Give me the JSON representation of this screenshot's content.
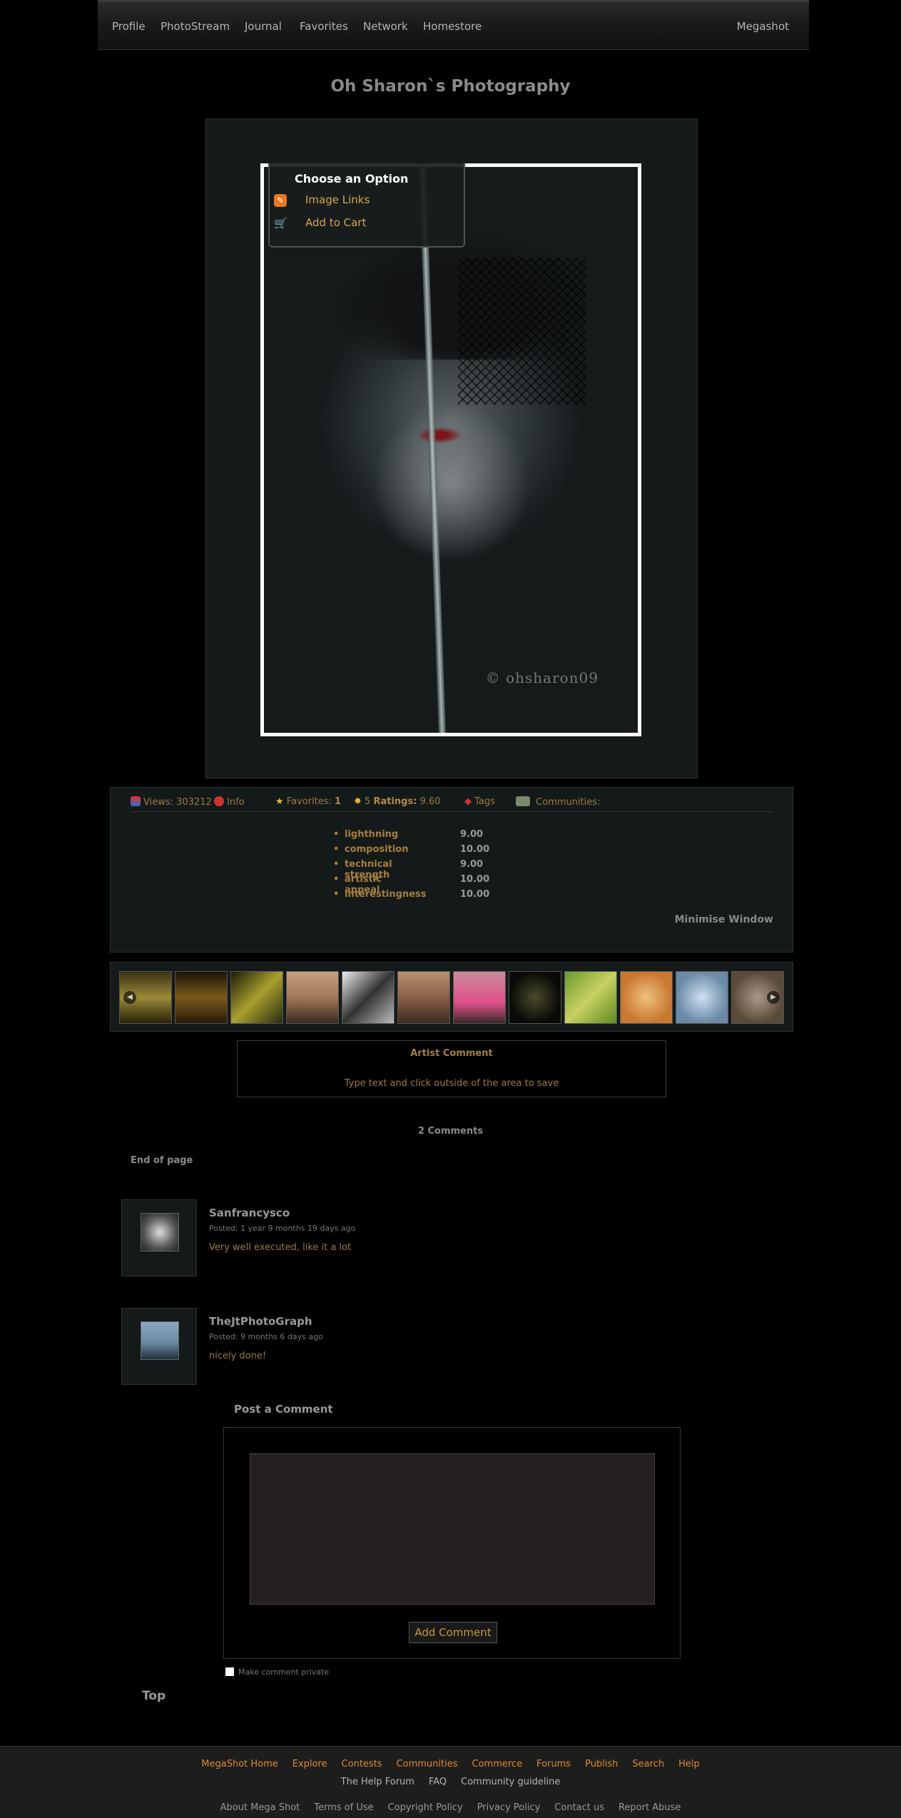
{
  "nav": {
    "items": [
      "Profile",
      "PhotoStream",
      "Journal",
      "Favorites",
      "Network",
      "Homestore"
    ],
    "right": "Megashot"
  },
  "site_title": "Oh Sharon`s Photography",
  "photo": {
    "watermark": "© ohsharon09"
  },
  "option_menu": {
    "title": "Choose an Option",
    "items": [
      {
        "label": "Image Links",
        "icon": "link-icon"
      },
      {
        "label": "Add to Cart",
        "icon": "cart-icon"
      }
    ]
  },
  "info_bar": {
    "views_label": "Views:",
    "views_value": "303212",
    "info_label": "Info",
    "favorites_label": "Favorites:",
    "favorites_value": "1",
    "ratings_count": "5",
    "ratings_label": "Ratings:",
    "ratings_value": "9.60",
    "tags_label": "Tags",
    "communities_label": "Communities:"
  },
  "ratings": [
    {
      "name": "lighthning",
      "value": "9.00"
    },
    {
      "name": "composition",
      "value": "10.00"
    },
    {
      "name": "technical strength",
      "value": "9.00"
    },
    {
      "name": "artistic appeal",
      "value": "10.00"
    },
    {
      "name": "interestingness",
      "value": "10.00"
    }
  ],
  "minimise_label": "Minimise Window",
  "thumbnails": [
    "#6b5a22",
    "#5a4216",
    "#6a6418",
    "#8c6a52",
    "#9a9a9a",
    "#7a5a48",
    "#9e5a6a",
    "#2a2a1a",
    "#8aa840",
    "#c88a48",
    "#8aa8c0",
    "#7a6a5a"
  ],
  "artist_comment": {
    "title": "Artist Comment",
    "hint": "Type text and click outside of the area to save"
  },
  "comments_header": "2 Comments",
  "end_of_page": "End of page",
  "comments": [
    {
      "name": "Sanfrancysco",
      "posted": "Posted: 1 year 9 months 19 days ago",
      "text": "Very well executed, like it a lot"
    },
    {
      "name": "TheJtPhotoGraph",
      "posted": "Posted: 9 months 6 days ago",
      "text": "nicely done!"
    }
  ],
  "post_comment": {
    "title": "Post a Comment",
    "button": "Add Comment",
    "private_label": "Make comment private"
  },
  "top_link": "Top",
  "footer": {
    "row1": [
      "MegaShot Home",
      "Explore",
      "Contests",
      "Communities",
      "Commerce",
      "Forums",
      "Publish",
      "Search",
      "Help"
    ],
    "row2": [
      "The Help Forum",
      "FAQ",
      "Community guideline"
    ],
    "row3": [
      "About Mega Shot",
      "Terms of Use",
      "Copyright Policy",
      "Privacy Policy",
      "Contact us",
      "Report Abuse"
    ]
  },
  "colors": {
    "accent": "#a57e3e",
    "footer_link": "#e08a2a",
    "background": "#000000"
  }
}
